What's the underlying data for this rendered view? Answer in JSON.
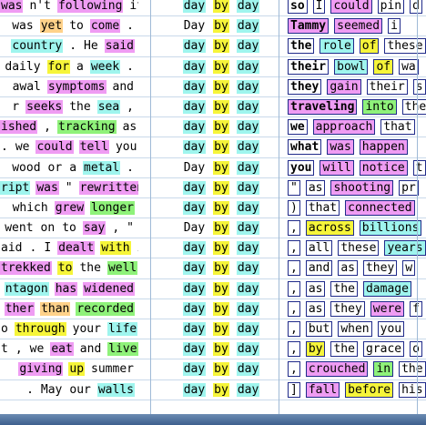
{
  "colors": {
    "cyan": "#9ff5ee",
    "pink": "#ef9cf3",
    "yellow": "#f6f53a",
    "green": "#8ff27a",
    "orange": "#ffd28a",
    "lavender": "#d2c4f3",
    "grid_line": "#9fbad6",
    "box_border": "#1f2a8a"
  },
  "rows": [
    {
      "left": [
        {
          "t": "was",
          "c": "pink"
        },
        {
          "t": "n't",
          "c": "none"
        },
        {
          "t": "following",
          "c": "pink"
        },
        {
          "t": "it",
          "c": "none"
        }
      ],
      "mid": [
        {
          "t": "day",
          "c": "cyan"
        },
        {
          "t": "by",
          "c": "yellow"
        },
        {
          "t": "day",
          "c": "cyan"
        }
      ],
      "right": [
        {
          "t": "so",
          "c": "none",
          "k": true
        },
        {
          "t": "I",
          "c": "none"
        },
        {
          "t": "could",
          "c": "pink"
        },
        {
          "t": "pin",
          "c": "none"
        },
        {
          "t": "d",
          "c": "none"
        }
      ]
    },
    {
      "left": [
        {
          "t": "was",
          "c": "none"
        },
        {
          "t": "yet",
          "c": "orange"
        },
        {
          "t": "to",
          "c": "none"
        },
        {
          "t": "come",
          "c": "pink"
        },
        {
          "t": ".",
          "c": "none"
        }
      ],
      "mid": [
        {
          "t": "Day",
          "c": "none"
        },
        {
          "t": "by",
          "c": "yellow"
        },
        {
          "t": "day",
          "c": "cyan"
        }
      ],
      "right": [
        {
          "t": "Tammy",
          "c": "pink",
          "k": true
        },
        {
          "t": "seemed",
          "c": "pink"
        },
        {
          "t": "i",
          "c": "none"
        }
      ]
    },
    {
      "left": [
        {
          "t": "country",
          "c": "cyan"
        },
        {
          "t": ".",
          "c": "none"
        },
        {
          "t": "He",
          "c": "none"
        },
        {
          "t": "said",
          "c": "pink"
        }
      ],
      "mid": [
        {
          "t": "day",
          "c": "cyan"
        },
        {
          "t": "by",
          "c": "yellow"
        },
        {
          "t": "day",
          "c": "cyan"
        }
      ],
      "right": [
        {
          "t": "the",
          "c": "none",
          "k": true
        },
        {
          "t": "role",
          "c": "cyan"
        },
        {
          "t": "of",
          "c": "yellow"
        },
        {
          "t": "these",
          "c": "none"
        }
      ]
    },
    {
      "left": [
        {
          "t": "daily",
          "c": "none"
        },
        {
          "t": "for",
          "c": "yellow"
        },
        {
          "t": "a",
          "c": "none"
        },
        {
          "t": "week",
          "c": "cyan"
        },
        {
          "t": ".",
          "c": "none"
        }
      ],
      "mid": [
        {
          "t": "day",
          "c": "cyan"
        },
        {
          "t": "by",
          "c": "yellow"
        },
        {
          "t": "day",
          "c": "cyan"
        }
      ],
      "right": [
        {
          "t": "their",
          "c": "none",
          "k": true
        },
        {
          "t": "bowl",
          "c": "cyan"
        },
        {
          "t": "of",
          "c": "yellow"
        },
        {
          "t": "wa",
          "c": "none"
        }
      ]
    },
    {
      "left": [
        {
          "t": "awal",
          "c": "none"
        },
        {
          "t": "symptoms",
          "c": "pink"
        },
        {
          "t": "and",
          "c": "none"
        }
      ],
      "mid": [
        {
          "t": "day",
          "c": "cyan"
        },
        {
          "t": "by",
          "c": "yellow"
        },
        {
          "t": "day",
          "c": "cyan"
        }
      ],
      "right": [
        {
          "t": "they",
          "c": "none",
          "k": true
        },
        {
          "t": "gain",
          "c": "pink"
        },
        {
          "t": "their",
          "c": "none"
        },
        {
          "t": "s",
          "c": "none"
        }
      ]
    },
    {
      "left": [
        {
          "t": "r",
          "c": "none"
        },
        {
          "t": "seeks",
          "c": "pink"
        },
        {
          "t": "the",
          "c": "none"
        },
        {
          "t": "sea",
          "c": "cyan"
        },
        {
          "t": ",",
          "c": "none"
        }
      ],
      "mid": [
        {
          "t": "day",
          "c": "cyan"
        },
        {
          "t": "by",
          "c": "yellow"
        },
        {
          "t": "day",
          "c": "cyan"
        }
      ],
      "right": [
        {
          "t": "traveling",
          "c": "pink",
          "k": true
        },
        {
          "t": "into",
          "c": "green"
        },
        {
          "t": "the",
          "c": "none"
        }
      ]
    },
    {
      "left": [
        {
          "t": "ished",
          "c": "pink"
        },
        {
          "t": ",",
          "c": "none"
        },
        {
          "t": "tracking",
          "c": "green"
        },
        {
          "t": "as",
          "c": "none"
        }
      ],
      "mid": [
        {
          "t": "day",
          "c": "cyan"
        },
        {
          "t": "by",
          "c": "yellow"
        },
        {
          "t": "day",
          "c": "cyan"
        }
      ],
      "right": [
        {
          "t": "we",
          "c": "none",
          "k": true
        },
        {
          "t": "approach",
          "c": "pink"
        },
        {
          "t": "that",
          "c": "none"
        }
      ]
    },
    {
      "left": [
        {
          "t": ".",
          "c": "none"
        },
        {
          "t": "we",
          "c": "none"
        },
        {
          "t": "could",
          "c": "pink"
        },
        {
          "t": "tell",
          "c": "pink"
        },
        {
          "t": "you",
          "c": "none"
        }
      ],
      "mid": [
        {
          "t": "day",
          "c": "cyan"
        },
        {
          "t": "by",
          "c": "yellow"
        },
        {
          "t": "day",
          "c": "cyan"
        }
      ],
      "right": [
        {
          "t": "what",
          "c": "none",
          "k": true
        },
        {
          "t": "was",
          "c": "pink"
        },
        {
          "t": "happen",
          "c": "pink"
        }
      ]
    },
    {
      "left": [
        {
          "t": "wood",
          "c": "none"
        },
        {
          "t": "or",
          "c": "none"
        },
        {
          "t": "a",
          "c": "none"
        },
        {
          "t": "metal",
          "c": "cyan"
        },
        {
          "t": ".",
          "c": "none"
        }
      ],
      "mid": [
        {
          "t": "Day",
          "c": "none"
        },
        {
          "t": "by",
          "c": "yellow"
        },
        {
          "t": "day",
          "c": "cyan"
        }
      ],
      "right": [
        {
          "t": "you",
          "c": "none",
          "k": true
        },
        {
          "t": "will",
          "c": "pink"
        },
        {
          "t": "notice",
          "c": "pink"
        },
        {
          "t": "t",
          "c": "none"
        }
      ]
    },
    {
      "left": [
        {
          "t": "ript",
          "c": "cyan"
        },
        {
          "t": "was",
          "c": "pink"
        },
        {
          "t": "\"",
          "c": "none"
        },
        {
          "t": "rewritten",
          "c": "pink"
        }
      ],
      "mid": [
        {
          "t": "day",
          "c": "cyan"
        },
        {
          "t": "by",
          "c": "yellow"
        },
        {
          "t": "day",
          "c": "cyan"
        }
      ],
      "right": [
        {
          "t": "\"",
          "c": "none"
        },
        {
          "t": "as",
          "c": "none"
        },
        {
          "t": "shooting",
          "c": "pink"
        },
        {
          "t": "pr",
          "c": "none"
        }
      ]
    },
    {
      "left": [
        {
          "t": "which",
          "c": "none"
        },
        {
          "t": "grew",
          "c": "pink"
        },
        {
          "t": "longer",
          "c": "green"
        }
      ],
      "mid": [
        {
          "t": "day",
          "c": "cyan"
        },
        {
          "t": "by",
          "c": "yellow"
        },
        {
          "t": "day",
          "c": "cyan"
        }
      ],
      "right": [
        {
          "t": ")",
          "c": "none"
        },
        {
          "t": "that",
          "c": "none"
        },
        {
          "t": "connected",
          "c": "pink"
        }
      ]
    },
    {
      "left": [
        {
          "t": "went",
          "c": "none"
        },
        {
          "t": "on",
          "c": "none"
        },
        {
          "t": "to",
          "c": "none"
        },
        {
          "t": "say",
          "c": "pink"
        },
        {
          "t": ",",
          "c": "none"
        },
        {
          "t": "\"",
          "c": "none"
        }
      ],
      "mid": [
        {
          "t": "Day",
          "c": "none"
        },
        {
          "t": "by",
          "c": "yellow"
        },
        {
          "t": "day",
          "c": "cyan"
        }
      ],
      "right": [
        {
          "t": ",",
          "c": "none"
        },
        {
          "t": "across",
          "c": "yellow"
        },
        {
          "t": "billions",
          "c": "cyan"
        }
      ]
    },
    {
      "left": [
        {
          "t": "aid",
          "c": "none"
        },
        {
          "t": ".",
          "c": "none"
        },
        {
          "t": "I",
          "c": "none"
        },
        {
          "t": "dealt",
          "c": "pink"
        },
        {
          "t": "with",
          "c": "yellow"
        },
        {
          "t": "it",
          "c": "none"
        }
      ],
      "mid": [
        {
          "t": "day",
          "c": "cyan"
        },
        {
          "t": "by",
          "c": "yellow"
        },
        {
          "t": "day",
          "c": "cyan"
        }
      ],
      "right": [
        {
          "t": ",",
          "c": "none"
        },
        {
          "t": "all",
          "c": "none"
        },
        {
          "t": "these",
          "c": "none"
        },
        {
          "t": "years",
          "c": "cyan"
        }
      ]
    },
    {
      "left": [
        {
          "t": "trekked",
          "c": "pink"
        },
        {
          "t": "to",
          "c": "yellow"
        },
        {
          "t": "the",
          "c": "none"
        },
        {
          "t": "well",
          "c": "green"
        }
      ],
      "mid": [
        {
          "t": "day",
          "c": "cyan"
        },
        {
          "t": "by",
          "c": "yellow"
        },
        {
          "t": "day",
          "c": "cyan"
        }
      ],
      "right": [
        {
          "t": ",",
          "c": "none"
        },
        {
          "t": "and",
          "c": "none"
        },
        {
          "t": "as",
          "c": "none"
        },
        {
          "t": "they",
          "c": "none"
        },
        {
          "t": "w",
          "c": "none"
        }
      ]
    },
    {
      "left": [
        {
          "t": "ntagon",
          "c": "cyan"
        },
        {
          "t": "has",
          "c": "pink"
        },
        {
          "t": "widened",
          "c": "pink"
        }
      ],
      "mid": [
        {
          "t": "day",
          "c": "cyan"
        },
        {
          "t": "by",
          "c": "yellow"
        },
        {
          "t": "day",
          "c": "cyan"
        }
      ],
      "right": [
        {
          "t": ",",
          "c": "none"
        },
        {
          "t": "as",
          "c": "none"
        },
        {
          "t": "the",
          "c": "none"
        },
        {
          "t": "damage",
          "c": "cyan"
        }
      ]
    },
    {
      "left": [
        {
          "t": "ther",
          "c": "pink"
        },
        {
          "t": "than",
          "c": "orange"
        },
        {
          "t": "recorded",
          "c": "green"
        }
      ],
      "mid": [
        {
          "t": "day",
          "c": "cyan"
        },
        {
          "t": "by",
          "c": "yellow"
        },
        {
          "t": "day",
          "c": "cyan"
        }
      ],
      "right": [
        {
          "t": ",",
          "c": "none"
        },
        {
          "t": "as",
          "c": "none"
        },
        {
          "t": "they",
          "c": "none"
        },
        {
          "t": "were",
          "c": "pink"
        },
        {
          "t": "f",
          "c": "none"
        }
      ]
    },
    {
      "left": [
        {
          "t": "o",
          "c": "none"
        },
        {
          "t": "through",
          "c": "yellow"
        },
        {
          "t": "your",
          "c": "none"
        },
        {
          "t": "life",
          "c": "cyan"
        }
      ],
      "mid": [
        {
          "t": "day",
          "c": "cyan"
        },
        {
          "t": "by",
          "c": "yellow"
        },
        {
          "t": "day",
          "c": "cyan"
        }
      ],
      "right": [
        {
          "t": ",",
          "c": "none"
        },
        {
          "t": "but",
          "c": "none"
        },
        {
          "t": "when",
          "c": "none"
        },
        {
          "t": "you",
          "c": "none"
        }
      ]
    },
    {
      "left": [
        {
          "t": "t",
          "c": "none"
        },
        {
          "t": ",",
          "c": "none"
        },
        {
          "t": "we",
          "c": "none"
        },
        {
          "t": "eat",
          "c": "pink"
        },
        {
          "t": "and",
          "c": "none"
        },
        {
          "t": "live",
          "c": "green"
        }
      ],
      "mid": [
        {
          "t": "day",
          "c": "cyan"
        },
        {
          "t": "by",
          "c": "yellow"
        },
        {
          "t": "day",
          "c": "cyan"
        }
      ],
      "right": [
        {
          "t": ",",
          "c": "none"
        },
        {
          "t": "by",
          "c": "yellow"
        },
        {
          "t": "the",
          "c": "none"
        },
        {
          "t": "grace",
          "c": "none"
        },
        {
          "t": "o",
          "c": "none"
        }
      ]
    },
    {
      "left": [
        {
          "t": "giving",
          "c": "pink"
        },
        {
          "t": "up",
          "c": "yellow"
        },
        {
          "t": "summer",
          "c": "none"
        }
      ],
      "mid": [
        {
          "t": "day",
          "c": "cyan"
        },
        {
          "t": "by",
          "c": "yellow"
        },
        {
          "t": "day",
          "c": "cyan"
        }
      ],
      "right": [
        {
          "t": ",",
          "c": "none"
        },
        {
          "t": "crouched",
          "c": "pink"
        },
        {
          "t": "in",
          "c": "green"
        },
        {
          "t": "the",
          "c": "none"
        }
      ]
    },
    {
      "left": [
        {
          "t": ".",
          "c": "none"
        },
        {
          "t": "May",
          "c": "none"
        },
        {
          "t": "our",
          "c": "none"
        },
        {
          "t": "walls",
          "c": "cyan"
        }
      ],
      "mid": [
        {
          "t": "day",
          "c": "cyan"
        },
        {
          "t": "by",
          "c": "yellow"
        },
        {
          "t": "day",
          "c": "cyan"
        }
      ],
      "right": [
        {
          "t": "]",
          "c": "none"
        },
        {
          "t": "fall",
          "c": "pink"
        },
        {
          "t": "before",
          "c": "yellow"
        },
        {
          "t": "his",
          "c": "none"
        }
      ]
    }
  ]
}
